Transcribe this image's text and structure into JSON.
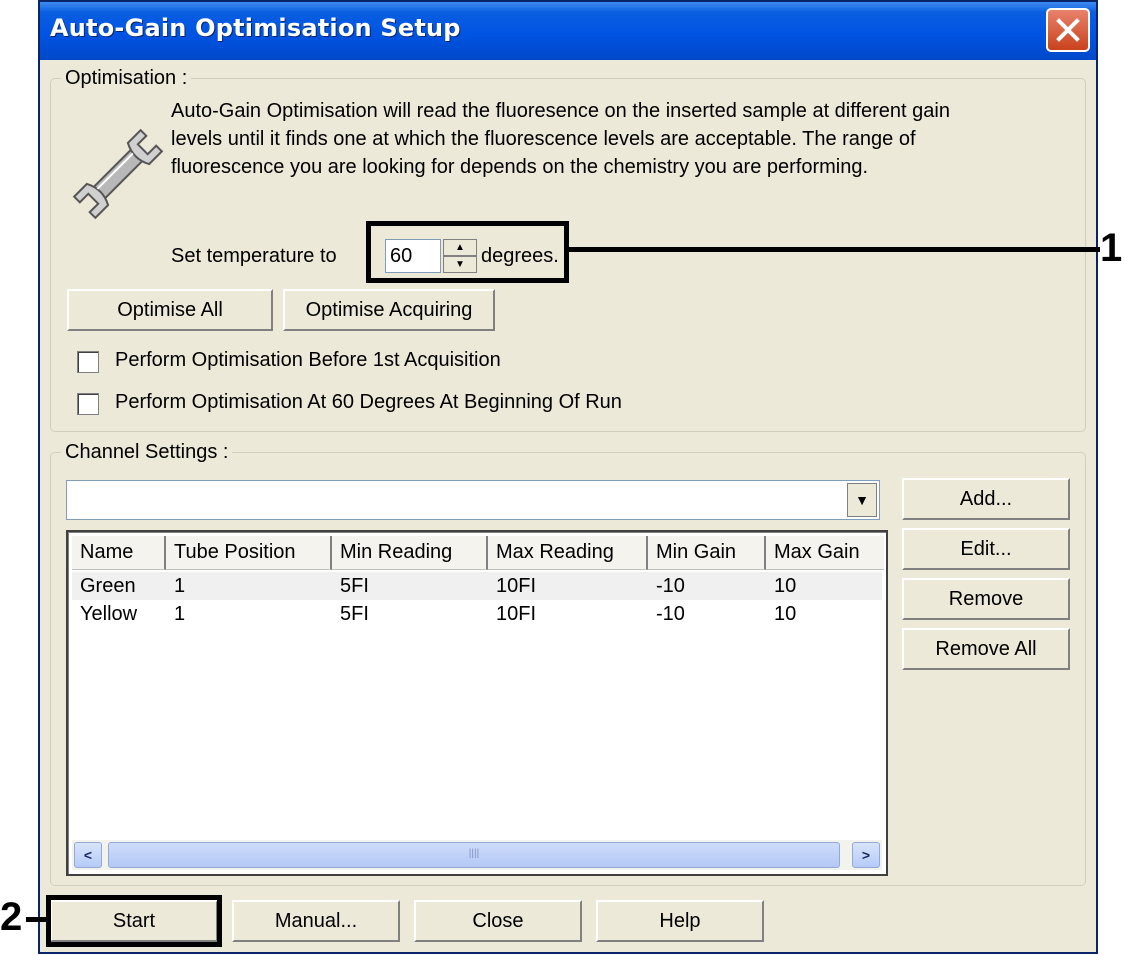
{
  "dialog": {
    "title": "Auto-Gain Optimisation Setup"
  },
  "optimisation": {
    "legend": "Optimisation :",
    "description": "Auto-Gain Optimisation will read the fluoresence on the inserted sample at different gain levels until it finds one at which the fluorescence levels are acceptable. The range of fluorescence you are looking for depends on the chemistry you are performing.",
    "temperature_label": "Set temperature to",
    "temperature_value": "60",
    "temperature_unit": "degrees.",
    "optimise_all_label": "Optimise All",
    "optimise_acquiring_label": "Optimise Acquiring",
    "checkbox1_label": "Perform Optimisation Before 1st Acquisition",
    "checkbox2_label": "Perform Optimisation At 60 Degrees At Beginning Of Run"
  },
  "channel_settings": {
    "legend": "Channel Settings :",
    "combo_value": "",
    "columns": [
      "Name",
      "Tube Position",
      "Min Reading",
      "Max Reading",
      "Min Gain",
      "Max Gain"
    ],
    "rows": [
      [
        "Green",
        "1",
        "5FI",
        "10FI",
        "-10",
        "10"
      ],
      [
        "Yellow",
        "1",
        "5FI",
        "10FI",
        "-10",
        "10"
      ]
    ],
    "add_label": "Add...",
    "edit_label": "Edit...",
    "remove_label": "Remove",
    "remove_all_label": "Remove All"
  },
  "footer": {
    "start_label": "Start",
    "manual_label": "Manual...",
    "close_label": "Close",
    "help_label": "Help"
  },
  "annotations": {
    "callout_1": "1",
    "callout_2": "2"
  },
  "icons": {
    "close": "close-icon",
    "settings": "wrench-icon"
  }
}
